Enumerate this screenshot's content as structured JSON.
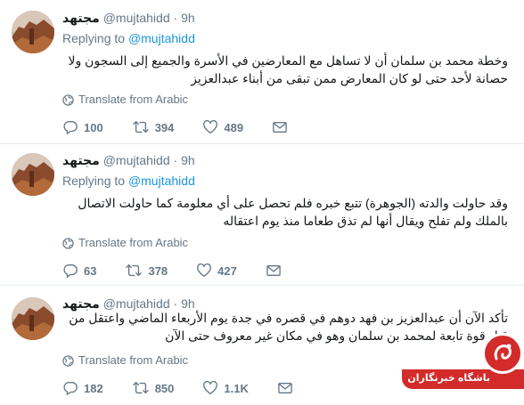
{
  "tweets": [
    {
      "name": "مجتهد",
      "handle": "@mujtahidd",
      "separator": "·",
      "time": "9h",
      "replying_prefix": "Replying to",
      "replying_to": "@mujtahidd",
      "text": "وخطة محمد بن سلمان أن لا تساهل مع المعارضين في الأسرة والجميع إلى السجون ولا حصانة لأحد حتى لو كان المعارض ممن تبقى من أبناء عبدالعزيز",
      "translate": "Translate from Arabic",
      "replies": "100",
      "retweets": "394",
      "likes": "489"
    },
    {
      "name": "مجتهد",
      "handle": "@mujtahidd",
      "separator": "·",
      "time": "9h",
      "replying_prefix": "Replying to",
      "replying_to": "@mujtahidd",
      "text": "وقد حاولت والدته (الجوهرة) تتبع خبره فلم تحصل على أي معلومة كما حاولت الاتصال بالملك ولم تفلح ويقال أنها لم تذق طعاما منذ يوم اعتقاله",
      "translate": "Translate from Arabic",
      "replies": "63",
      "retweets": "378",
      "likes": "427"
    },
    {
      "name": "مجتهد",
      "handle": "@mujtahidd",
      "separator": "·",
      "time": "9h",
      "replying_prefix": "Replying to",
      "replying_to": "@mujtahidd",
      "text": "تأكد الآن أن عبدالعزيز بن فهد دوهم في قصره في جدة يوم الأربعاء الماضي واعتقل من قبل قوة تابعة لمحمد بن سلمان وهو في مكان غير معروف حتى الآن",
      "translate": "Translate from Arabic",
      "replies": "182",
      "retweets": "850",
      "likes": "1.1K"
    }
  ],
  "icons": {
    "avatar": "desert-landscape-avatar",
    "globe": "globe-icon",
    "reply": "reply-icon",
    "retweet": "retweet-icon",
    "like": "heart-icon",
    "message": "envelope-icon"
  },
  "watermark": {
    "text": "باشگاه خبرنگاران"
  },
  "colors": {
    "text": "#14171a",
    "muted": "#657786",
    "link": "#1b95e0",
    "divider": "#e6ecf0",
    "watermark": "#d32a2a"
  }
}
